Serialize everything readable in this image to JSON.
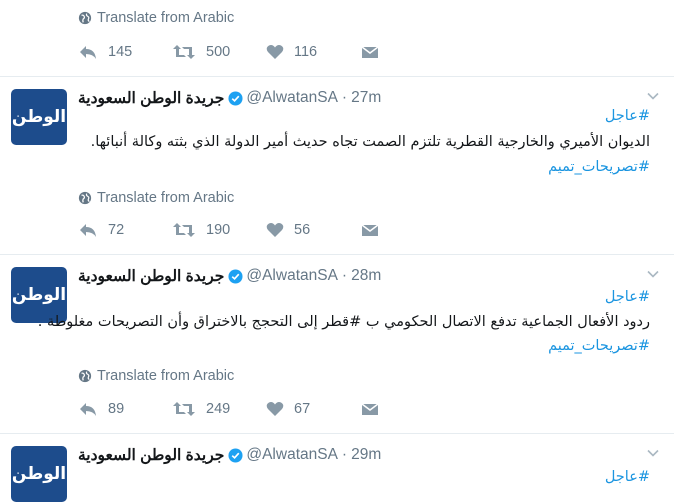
{
  "tweets": [
    {
      "translate": "Translate from Arabic",
      "reply_count": "145",
      "retweet_count": "500",
      "like_count": "116"
    },
    {
      "avatar_text": "الوطن",
      "name": "جريدة الوطن السعودية",
      "handle": "@AlwatanSA",
      "time": "27m",
      "lines": [
        "#عاجل",
        "الديوان الأميري والخارجية القطرية تلتزم الصمت تجاه حديث أمير الدولة الذي بثته وكالة أنبائها.",
        "#تصريحات_تميم"
      ],
      "translate": "Translate from Arabic",
      "reply_count": "72",
      "retweet_count": "190",
      "like_count": "56"
    },
    {
      "avatar_text": "الوطن",
      "name": "جريدة الوطن السعودية",
      "handle": "@AlwatanSA",
      "time": "28m",
      "lines": [
        "#عاجل",
        "ردود الأفعال الجماعية تدفع الاتصال الحكومي ب #قطر إلى التحجج بالاختراق وأن التصريحات مغلوطة .",
        "#تصريحات_تميم"
      ],
      "translate": "Translate from Arabic",
      "reply_count": "89",
      "retweet_count": "249",
      "like_count": "67"
    },
    {
      "avatar_text": "الوطن",
      "name": "جريدة الوطن السعودية",
      "handle": "@AlwatanSA",
      "time": "29m",
      "lines": [
        "#عاجل"
      ]
    }
  ],
  "separator": "·",
  "icons": {
    "verified": "verified-badge-icon",
    "caret": "chevron-down-icon",
    "globe": "globe-icon",
    "reply": "reply-icon",
    "retweet": "retweet-icon",
    "like": "heart-icon",
    "dm": "envelope-icon"
  },
  "colors": {
    "link": "#1b95e0",
    "muted": "#657786",
    "verified": "#1da1f2",
    "avatar_bg": "#1d4c8c"
  }
}
